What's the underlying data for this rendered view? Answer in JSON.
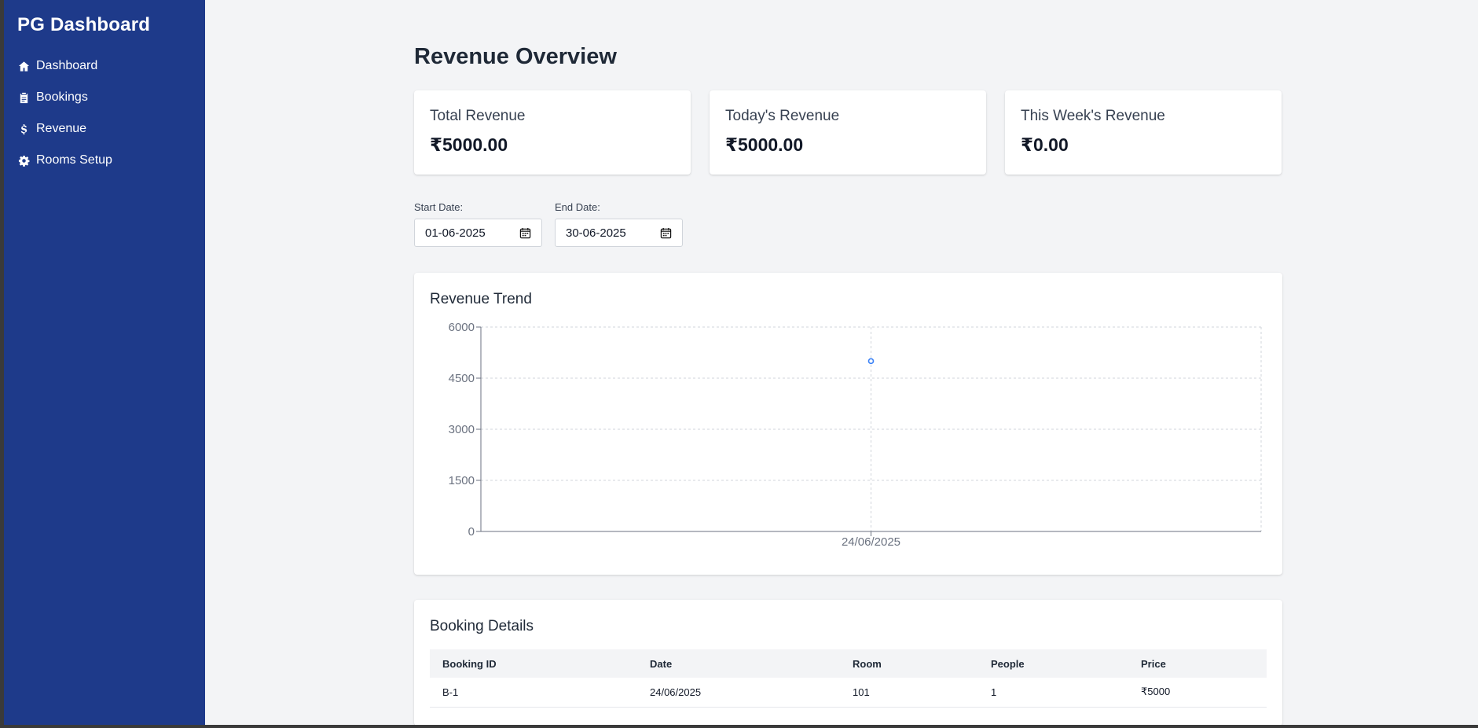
{
  "sidebar": {
    "brand": "PG Dashboard",
    "items": [
      {
        "label": "Dashboard",
        "icon": "home-icon"
      },
      {
        "label": "Bookings",
        "icon": "clipboard-icon"
      },
      {
        "label": "Revenue",
        "icon": "dollar-icon"
      },
      {
        "label": "Rooms Setup",
        "icon": "gear-icon"
      }
    ]
  },
  "page": {
    "title": "Revenue Overview"
  },
  "stats": [
    {
      "label": "Total Revenue",
      "value": "₹5000.00"
    },
    {
      "label": "Today's Revenue",
      "value": "₹5000.00"
    },
    {
      "label": "This Week's Revenue",
      "value": "₹0.00"
    }
  ],
  "filters": {
    "start": {
      "label": "Start Date:",
      "value": "01-06-2025"
    },
    "end": {
      "label": "End Date:",
      "value": "30-06-2025"
    }
  },
  "chart": {
    "title": "Revenue Trend",
    "accent_color": "#3b82f6"
  },
  "chart_data": {
    "type": "line",
    "title": "Revenue Trend",
    "x": [
      "24/06/2025"
    ],
    "series": [
      {
        "values": [
          5000
        ]
      }
    ],
    "ylim": [
      0,
      6000
    ],
    "yticks": [
      0,
      1500,
      3000,
      4500,
      6000
    ],
    "xlabel": "",
    "ylabel": "",
    "grid": true
  },
  "table": {
    "title": "Booking Details",
    "columns": [
      "Booking ID",
      "Date",
      "Room",
      "People",
      "Price"
    ],
    "rows": [
      [
        "B-1",
        "24/06/2025",
        "101",
        "1",
        "₹5000"
      ]
    ]
  }
}
